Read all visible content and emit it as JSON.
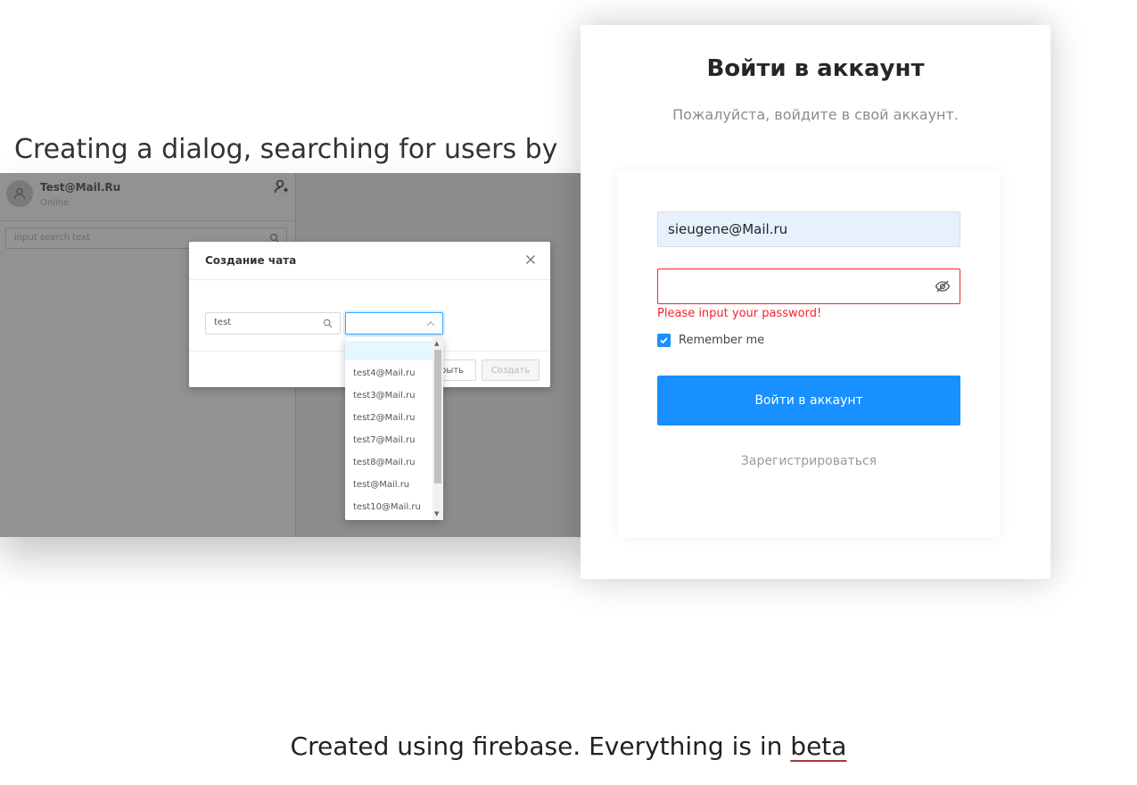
{
  "headline": "Creating a dialog, searching for users by email",
  "left_screenshot": {
    "user": {
      "name": "Test@Mail.Ru",
      "status": "Online"
    },
    "sidebar_search_placeholder": "input search text",
    "dialog": {
      "title": "Создание чата",
      "search_value": "test",
      "select_value": "",
      "close_button_label": "рыть",
      "create_button_label": "Создать"
    },
    "dropdown_options": [
      "test4@Mail.ru",
      "test3@Mail.ru",
      "test2@Mail.ru",
      "test7@Mail.ru",
      "test8@Mail.ru",
      "test@Mail.ru",
      "test10@Mail.ru"
    ]
  },
  "login": {
    "title": "Войти в аккаунт",
    "subtitle": "Пожалуйста, войдите в свой аккаунт.",
    "email_value": "sieugene@Mail.ru",
    "password_value": "",
    "password_error": "Please input your password!",
    "remember_label": "Remember me",
    "remember_checked": true,
    "submit_label": "Войти в аккаунт",
    "register_link": "Зарегистрироваться"
  },
  "caption": {
    "prefix": "Created using firebase. Everything is in ",
    "beta": "beta"
  },
  "colors": {
    "primary": "#1890ff",
    "error": "#f5222d",
    "autofill_background": "#e8f0fe"
  }
}
